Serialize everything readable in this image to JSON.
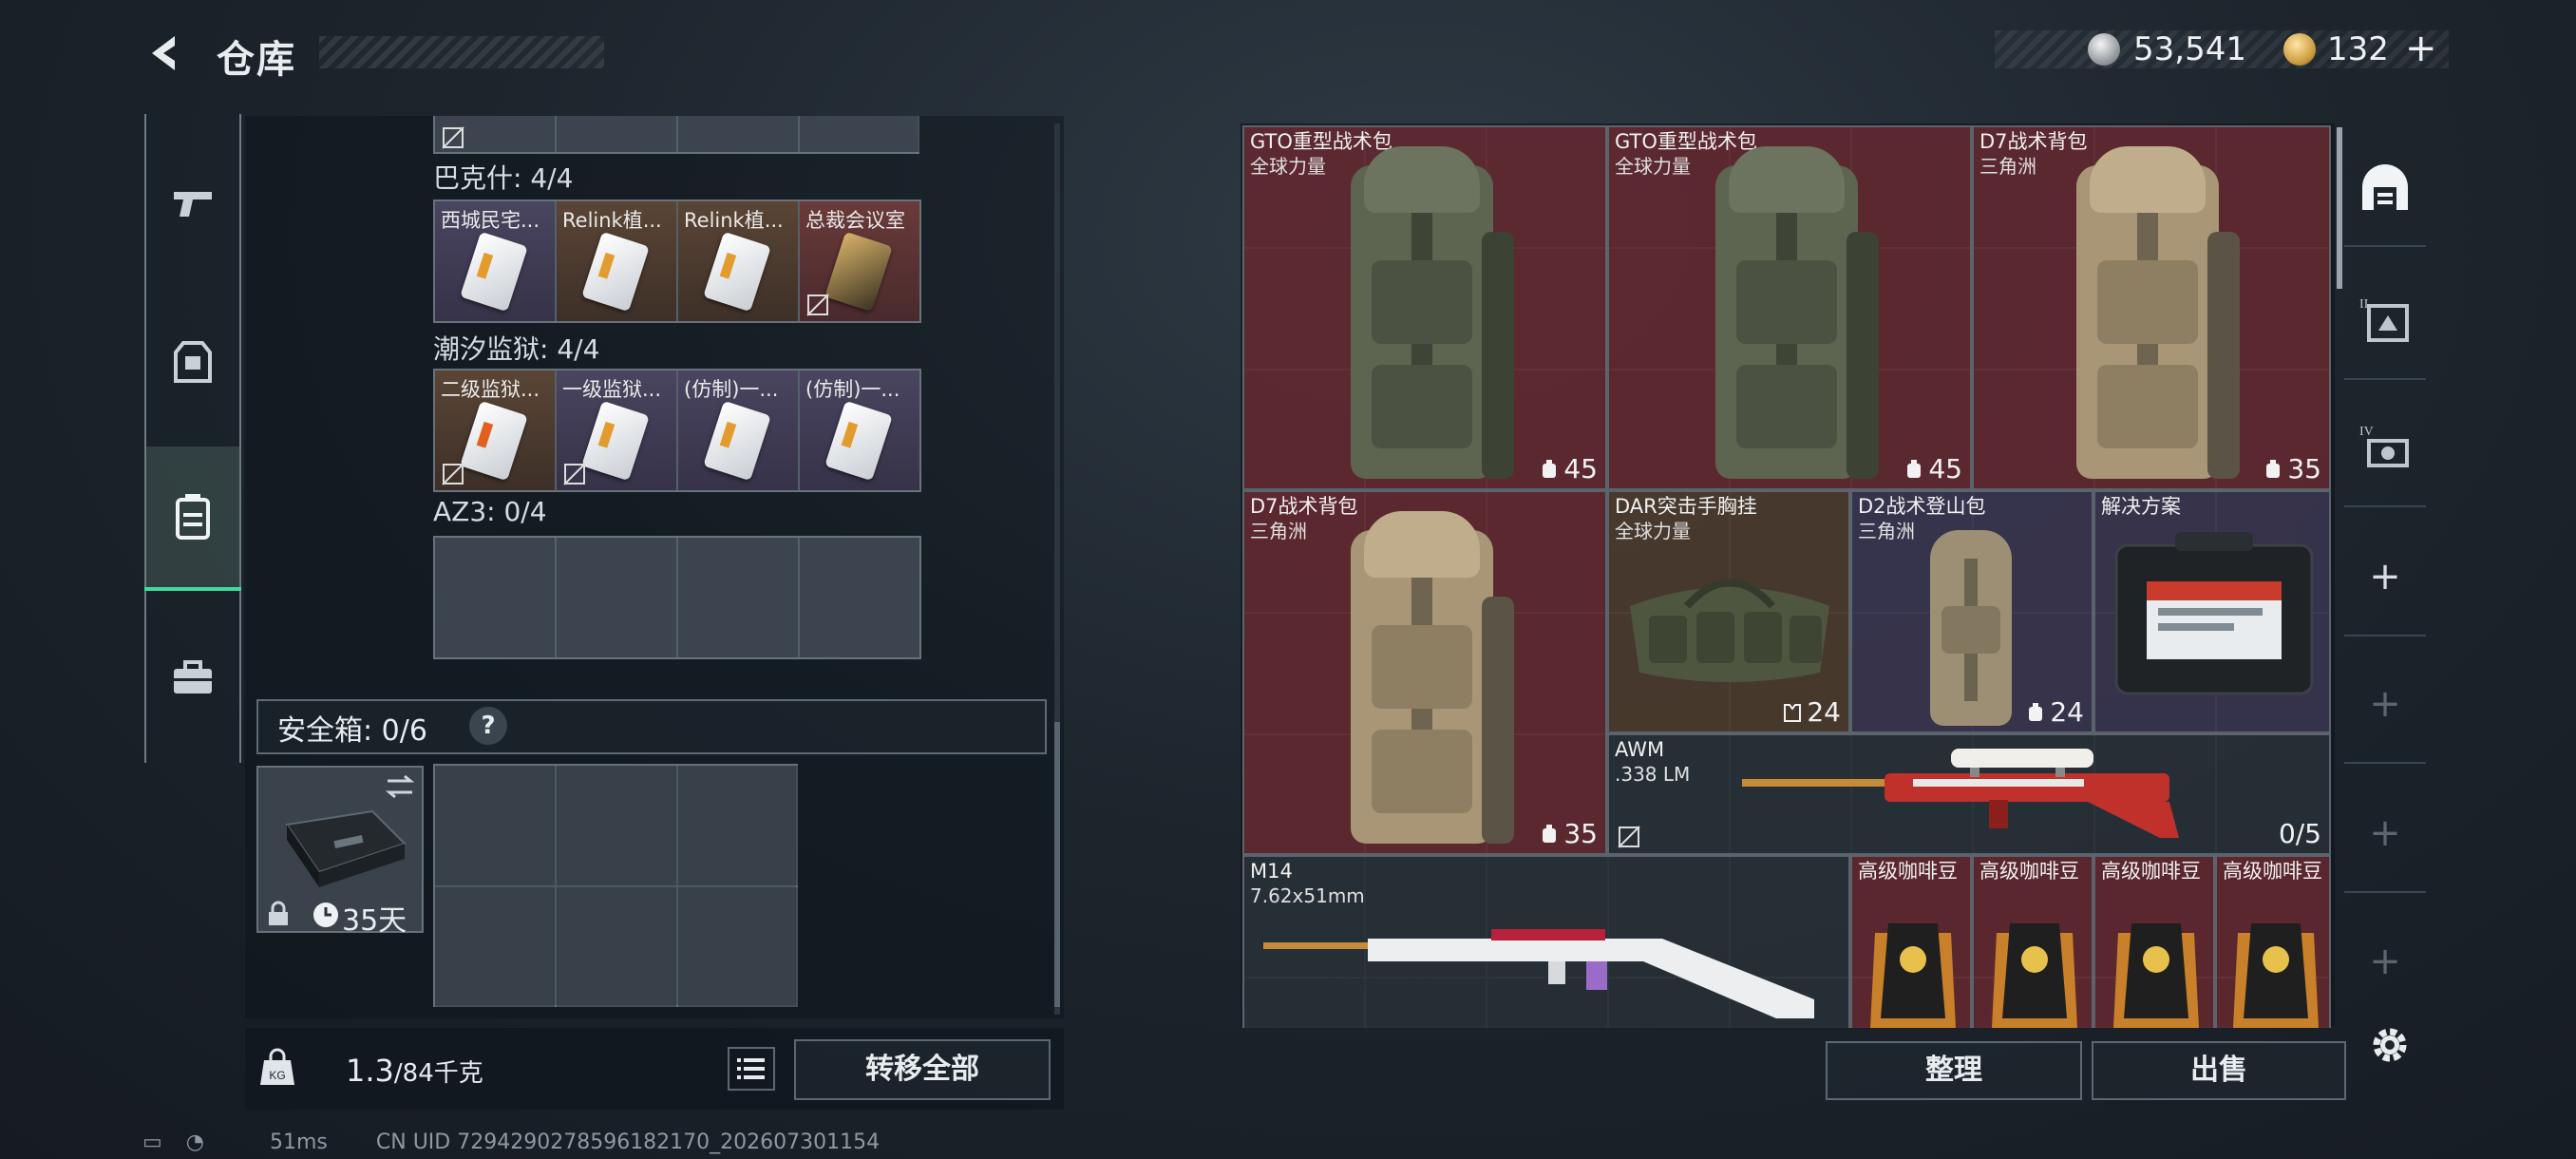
{
  "header": {
    "title": "仓库",
    "money": "53,541",
    "gold": "132",
    "gold_add": "+"
  },
  "left_rail": {
    "items": [
      {
        "name": "weapon",
        "active": false
      },
      {
        "name": "equipment",
        "active": false
      },
      {
        "name": "backpack",
        "active": true
      },
      {
        "name": "tools",
        "active": false
      }
    ]
  },
  "key_groups": [
    {
      "label": "巴克什: 4/4",
      "keys": [
        {
          "name": "西城民宅...",
          "tint": "purple",
          "card": "white",
          "no_drop": false
        },
        {
          "name": "Relink植...",
          "tint": "brown",
          "card": "white",
          "no_drop": false
        },
        {
          "name": "Relink植...",
          "tint": "brown",
          "card": "white",
          "no_drop": false
        },
        {
          "name": "总裁会议室",
          "tint": "red",
          "card": "gold",
          "no_drop": true
        }
      ]
    },
    {
      "label": "潮汐监狱: 4/4",
      "keys": [
        {
          "name": "二级监狱...",
          "tint": "brown",
          "card": "white",
          "no_drop": true
        },
        {
          "name": "一级监狱...",
          "tint": "purple",
          "card": "white",
          "no_drop": true
        },
        {
          "name": "(仿制)一...",
          "tint": "purple",
          "card": "white",
          "no_drop": false
        },
        {
          "name": "(仿制)一...",
          "tint": "purple",
          "card": "white",
          "no_drop": false
        }
      ]
    },
    {
      "label": "AZ3: 0/4",
      "keys": []
    }
  ],
  "safe_box": {
    "label": "安全箱: 0/6",
    "help": "?",
    "duration": "35天"
  },
  "weight": {
    "current": "1.3",
    "max": "/84千克"
  },
  "buttons": {
    "transfer_all": "转移全部",
    "sort": "整理",
    "sell": "出售"
  },
  "stash": {
    "items": [
      {
        "name": "GTO重型战术包",
        "sub": "全球力量",
        "cap": "45",
        "tint": "red",
        "kind": "pack-green"
      },
      {
        "name": "GTO重型战术包",
        "sub": "全球力量",
        "cap": "45",
        "tint": "red",
        "kind": "pack-green"
      },
      {
        "name": "D7战术背包",
        "sub": "三角洲",
        "cap": "35",
        "tint": "red",
        "kind": "pack-tan"
      },
      {
        "name": "D7战术背包",
        "sub": "三角洲",
        "cap": "35",
        "tint": "red",
        "kind": "pack-tan"
      },
      {
        "name": "DAR突击手胸挂",
        "sub": "全球力量",
        "cap": "24",
        "tint": "brown",
        "kind": "chest"
      },
      {
        "name": "D2战术登山包",
        "sub": "三角洲",
        "cap": "24",
        "tint": "purple",
        "kind": "pack-small"
      },
      {
        "name": "解决方案",
        "sub": "",
        "cap": "",
        "tint": "purple",
        "kind": "case"
      },
      {
        "name": "AWM",
        "sub": ".338 LM",
        "cap": "0/5",
        "tint": "gray",
        "kind": "rifle"
      },
      {
        "name": "M14",
        "sub": "7.62x51mm",
        "cap": "",
        "tint": "gray",
        "kind": "rifle"
      },
      {
        "name": "高级咖啡豆",
        "sub": "",
        "cap": "",
        "tint": "red",
        "kind": "coffee"
      },
      {
        "name": "高级咖啡豆",
        "sub": "",
        "cap": "",
        "tint": "red",
        "kind": "coffee"
      },
      {
        "name": "高级咖啡豆",
        "sub": "",
        "cap": "",
        "tint": "red",
        "kind": "coffee"
      },
      {
        "name": "高级咖啡豆",
        "sub": "",
        "cap": "",
        "tint": "red",
        "kind": "coffee"
      }
    ]
  },
  "status": {
    "ping": "51ms",
    "uid": "CN UID 7294290278596182170_202607301154"
  }
}
